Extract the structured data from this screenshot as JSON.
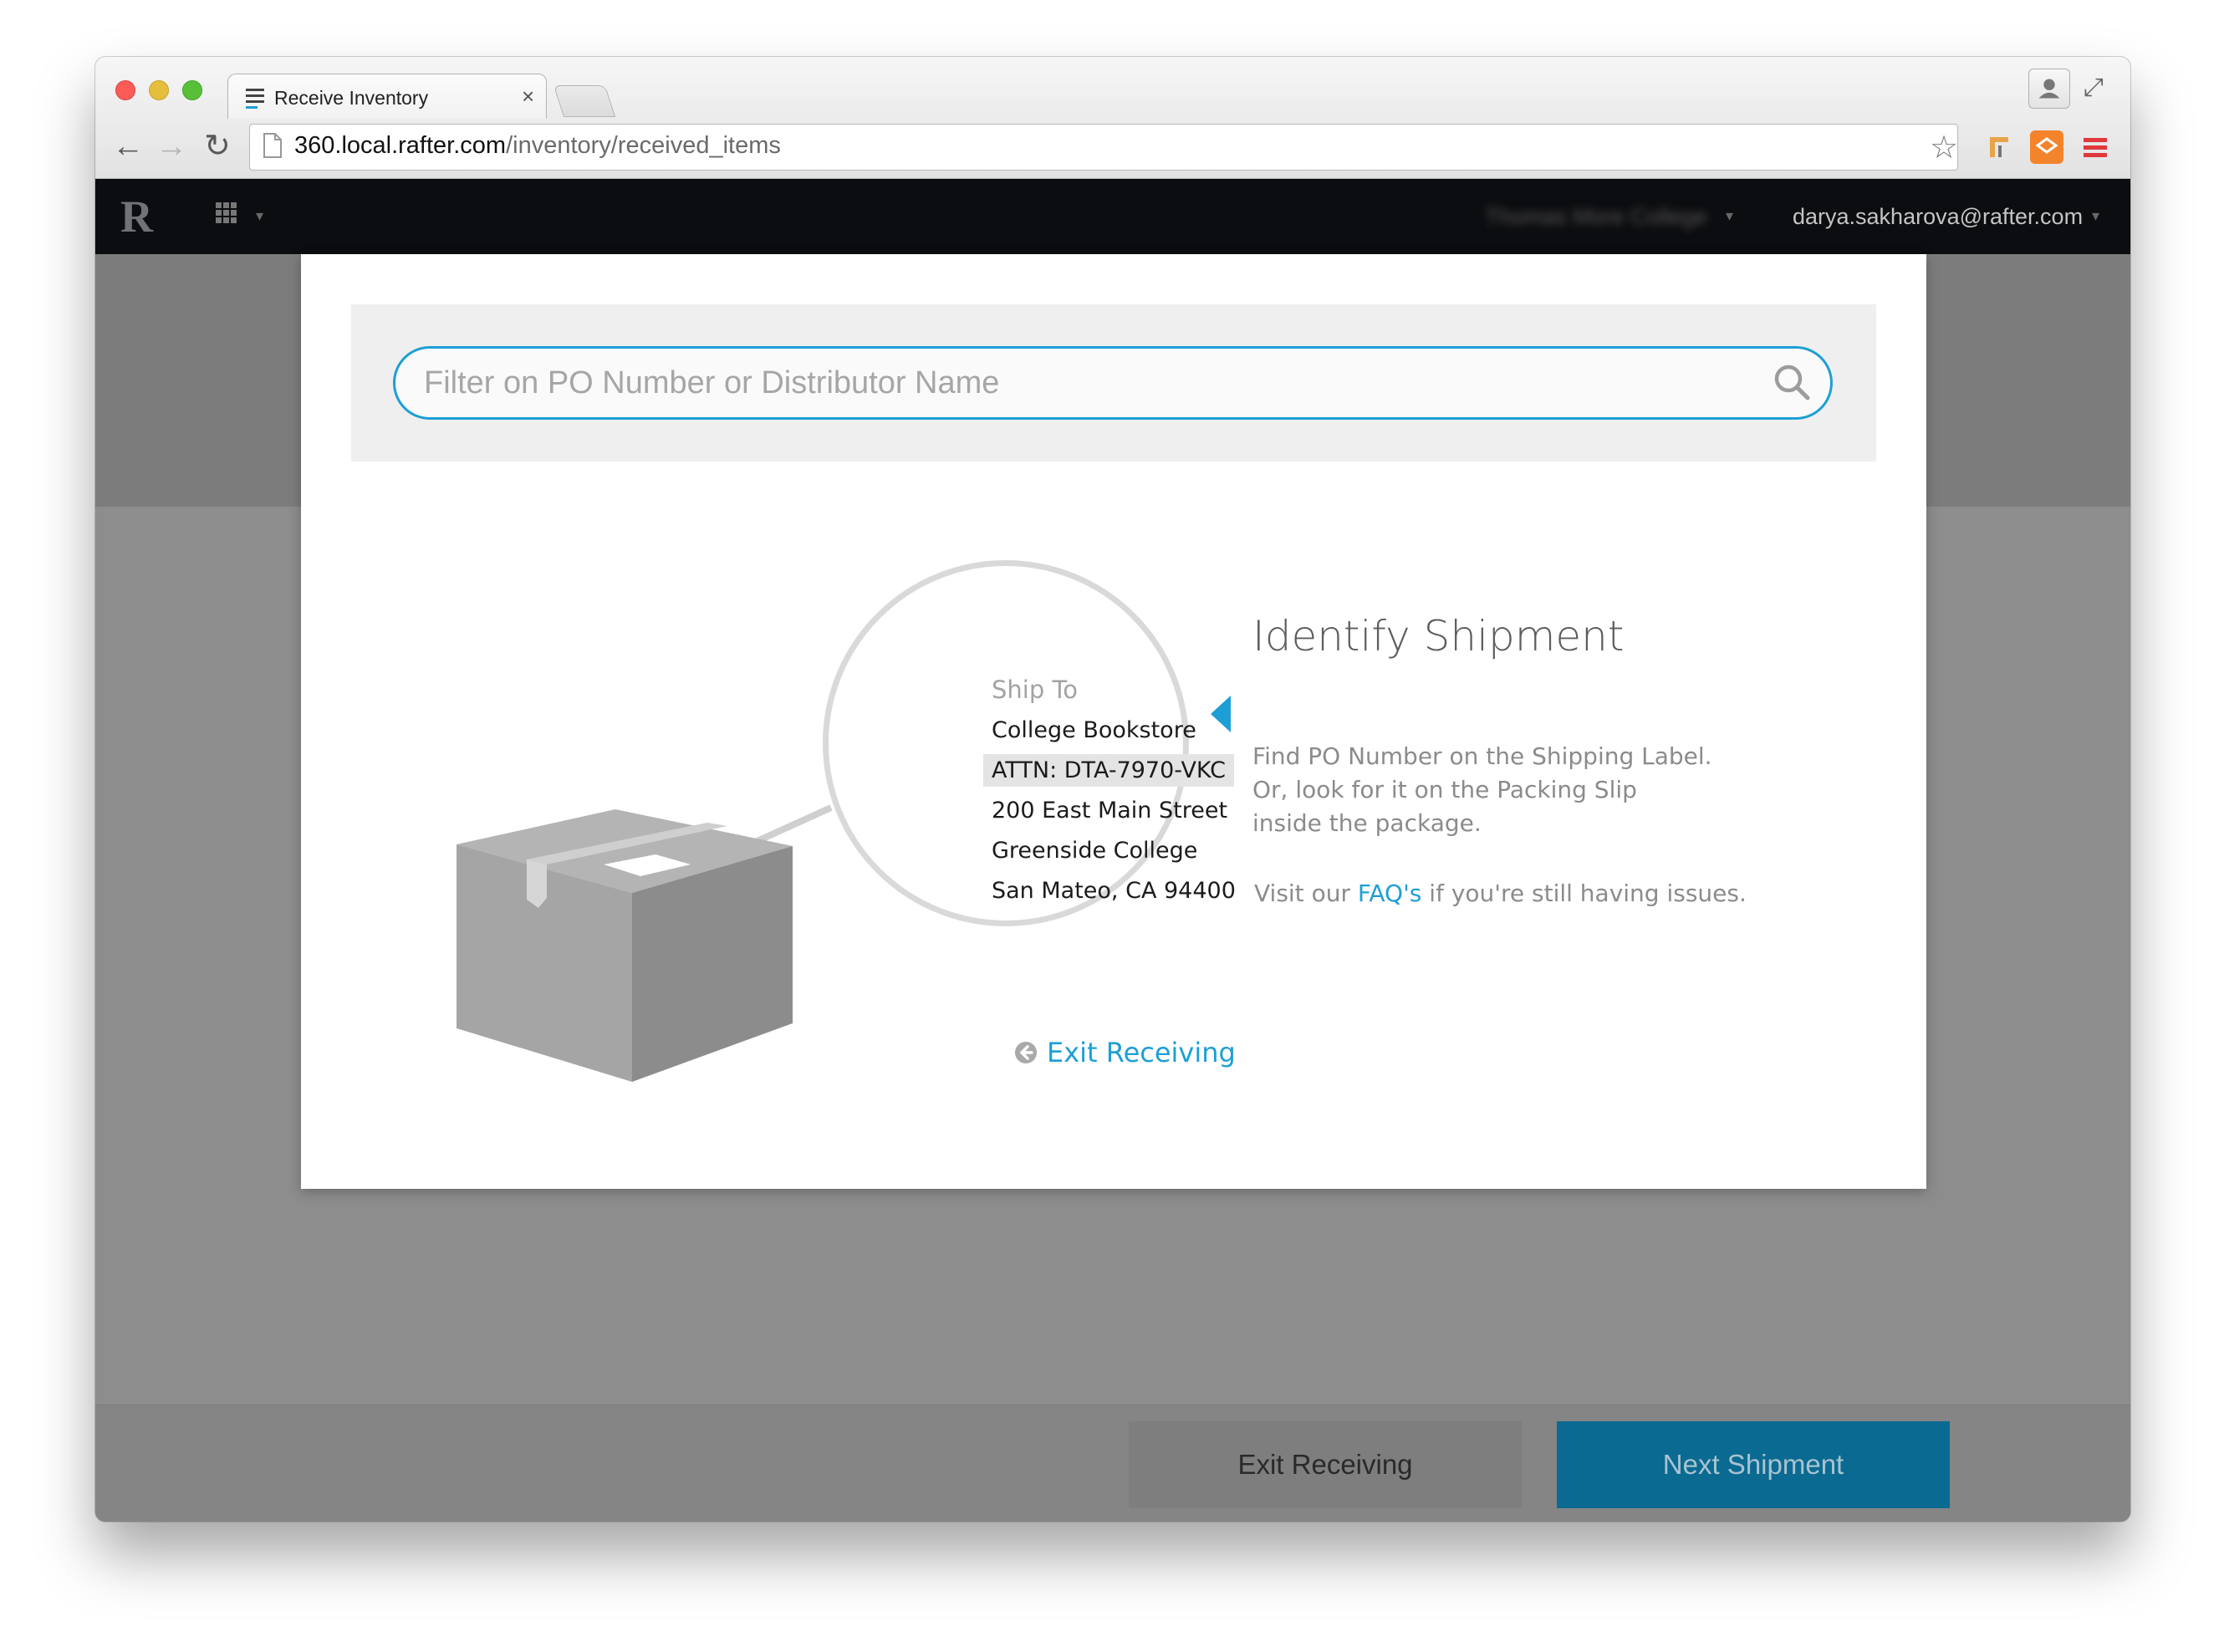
{
  "browser": {
    "tab_title": "Receive Inventory",
    "url_host": "360.local.rafter.com",
    "url_path": "/inventory/received_items",
    "close_glyph": "×",
    "back_glyph": "←",
    "forward_glyph": "→",
    "reload_glyph": "↻",
    "star_glyph": "☆",
    "expand_glyph": "⤢"
  },
  "appbar": {
    "logo": "R",
    "school": "Thomas More College",
    "user_email": "darya.sakharova@rafter.com",
    "caret": "▾"
  },
  "modal": {
    "search": {
      "placeholder": "Filter on PO Number or Distributor Name"
    },
    "label": {
      "heading": "Ship To",
      "lines": [
        "College Bookstore",
        "ATTN: DTA-7970-VKC",
        "200 East Main Street",
        "Greenside College",
        "San Mateo, CA 94400"
      ]
    },
    "identify": {
      "title": "Identify Shipment",
      "lines": [
        "Find PO Number on the Shipping Label.",
        "Or, look for it on the Packing Slip",
        "inside the package."
      ],
      "visit_prefix": "Visit our ",
      "faq_link": "FAQ's",
      "visit_suffix": " if you're still having issues."
    },
    "exit_link": "Exit Receiving"
  },
  "footer": {
    "exit_button": "Exit Receiving",
    "next_button": "Next Shipment"
  },
  "colors": {
    "accent": "#1d9fd5",
    "next_button_bg": "#0b6a91",
    "appbar_bg": "#0c0d10"
  },
  "icons": [
    "document-icon",
    "close-icon",
    "back-icon",
    "forward-icon",
    "reload-icon",
    "page-icon",
    "star-icon",
    "extension-icons",
    "apps-grid-icon",
    "search-icon",
    "arrow-left-icon",
    "circle-arrow-left-icon"
  ]
}
